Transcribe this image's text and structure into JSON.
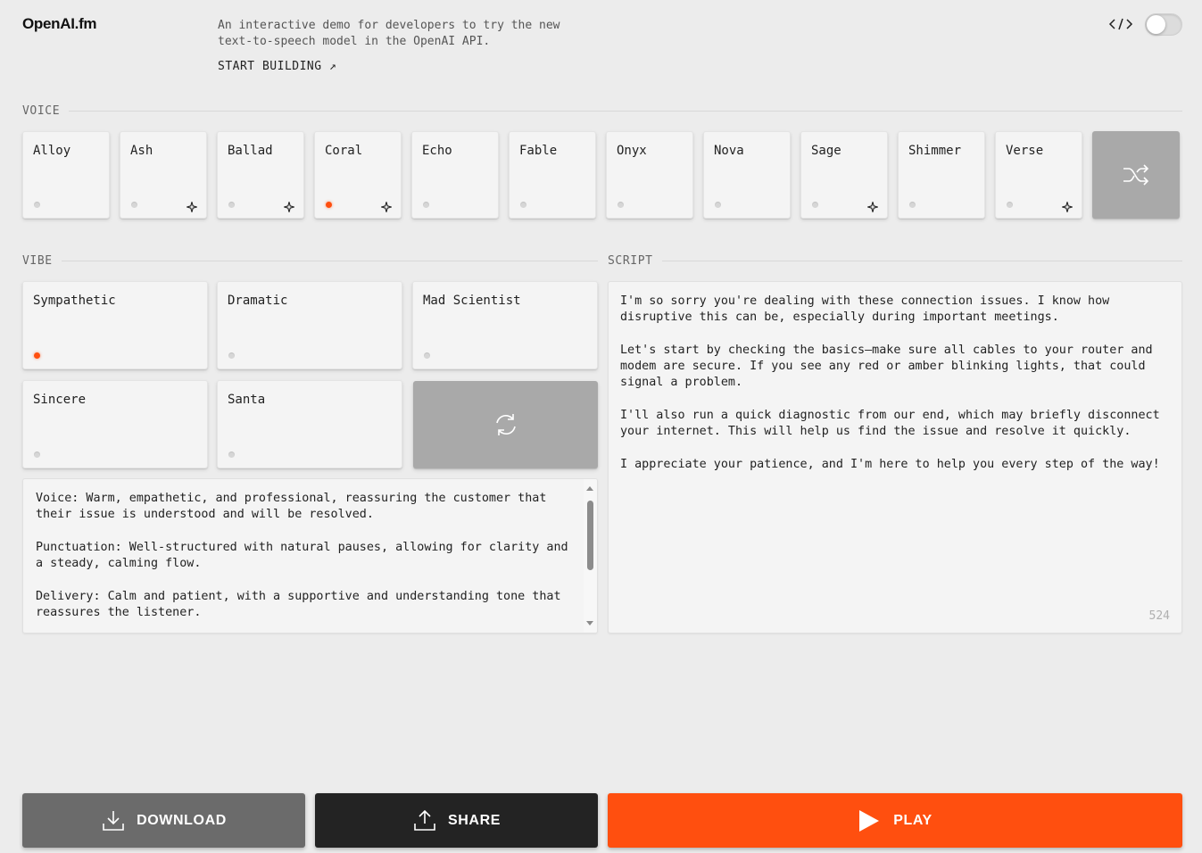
{
  "header": {
    "logo": "OpenAI.fm",
    "tagline": "An interactive demo for developers to try the new text-to-speech model in the OpenAI API.",
    "start_building": "START BUILDING ↗",
    "code_icon": "code-icon",
    "toggle_on": false
  },
  "voice_section": {
    "label": "VOICE",
    "voices": [
      {
        "name": "Alloy",
        "active": false,
        "sparkle": false
      },
      {
        "name": "Ash",
        "active": false,
        "sparkle": true
      },
      {
        "name": "Ballad",
        "active": false,
        "sparkle": true
      },
      {
        "name": "Coral",
        "active": true,
        "sparkle": true
      },
      {
        "name": "Echo",
        "active": false,
        "sparkle": false
      },
      {
        "name": "Fable",
        "active": false,
        "sparkle": false
      },
      {
        "name": "Onyx",
        "active": false,
        "sparkle": false
      },
      {
        "name": "Nova",
        "active": false,
        "sparkle": false
      },
      {
        "name": "Sage",
        "active": false,
        "sparkle": true
      },
      {
        "name": "Shimmer",
        "active": false,
        "sparkle": false
      },
      {
        "name": "Verse",
        "active": false,
        "sparkle": true
      }
    ],
    "shuffle_icon": "shuffle-icon"
  },
  "vibe_section": {
    "label": "VIBE",
    "vibes": [
      {
        "name": "Sympathetic",
        "active": true
      },
      {
        "name": "Dramatic",
        "active": false
      },
      {
        "name": "Mad Scientist",
        "active": false
      },
      {
        "name": "Sincere",
        "active": false
      },
      {
        "name": "Santa",
        "active": false
      }
    ],
    "refresh_icon": "refresh-icon",
    "description": "Voice: Warm, empathetic, and professional, reassuring the customer that their issue is understood and will be resolved.\n\nPunctuation: Well-structured with natural pauses, allowing for clarity and a steady, calming flow.\n\nDelivery: Calm and patient, with a supportive and understanding tone that reassures the listener."
  },
  "script_section": {
    "label": "SCRIPT",
    "text": "I'm so sorry you're dealing with these connection issues. I know how disruptive this can be, especially during important meetings.\n\nLet's start by checking the basics—make sure all cables to your router and modem are secure. If you see any red or amber blinking lights, that could signal a problem.\n\nI'll also run a quick diagnostic from our end, which may briefly disconnect your internet. This will help us find the issue and resolve it quickly.\n\nI appreciate your patience, and I'm here to help you every step of the way!",
    "char_count": "524"
  },
  "actions": {
    "download": "DOWNLOAD",
    "share": "SHARE",
    "play": "PLAY"
  },
  "colors": {
    "accent": "#ff4f0f",
    "background": "#ececec",
    "card": "#f4f4f4",
    "download_bg": "#6b6b6b",
    "share_bg": "#232323"
  }
}
